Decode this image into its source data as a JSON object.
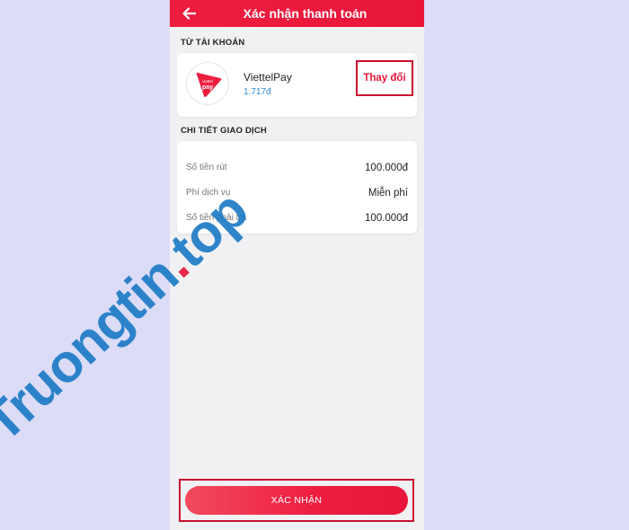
{
  "header": {
    "title": "Xác nhận thanh toán"
  },
  "from_account": {
    "section_label": "TỪ TÀI KHOẢN",
    "logo_text_top": "viettel",
    "logo_text_bottom": "pay",
    "name": "ViettelPay",
    "balance": "1.717đ",
    "change_label": "Thay đổi"
  },
  "transaction": {
    "section_label": "CHI TIẾT GIAO DỊCH",
    "rows": [
      {
        "label": "Số tiền rút",
        "value": "100.000đ"
      },
      {
        "label": "Phí dịch vụ",
        "value": "Miễn phí"
      },
      {
        "label": "Số tiền phải trả",
        "value": "100.000đ"
      }
    ]
  },
  "confirm": {
    "label": "XÁC NHẬN"
  },
  "watermark": {
    "part1": "Truongtin",
    "dot": ".",
    "part2": "top"
  },
  "colors": {
    "brand_red": "#e8163a",
    "balance_blue": "#2a8bd6",
    "page_bg": "#dcdcf7",
    "app_bg": "#f1f1f3"
  }
}
